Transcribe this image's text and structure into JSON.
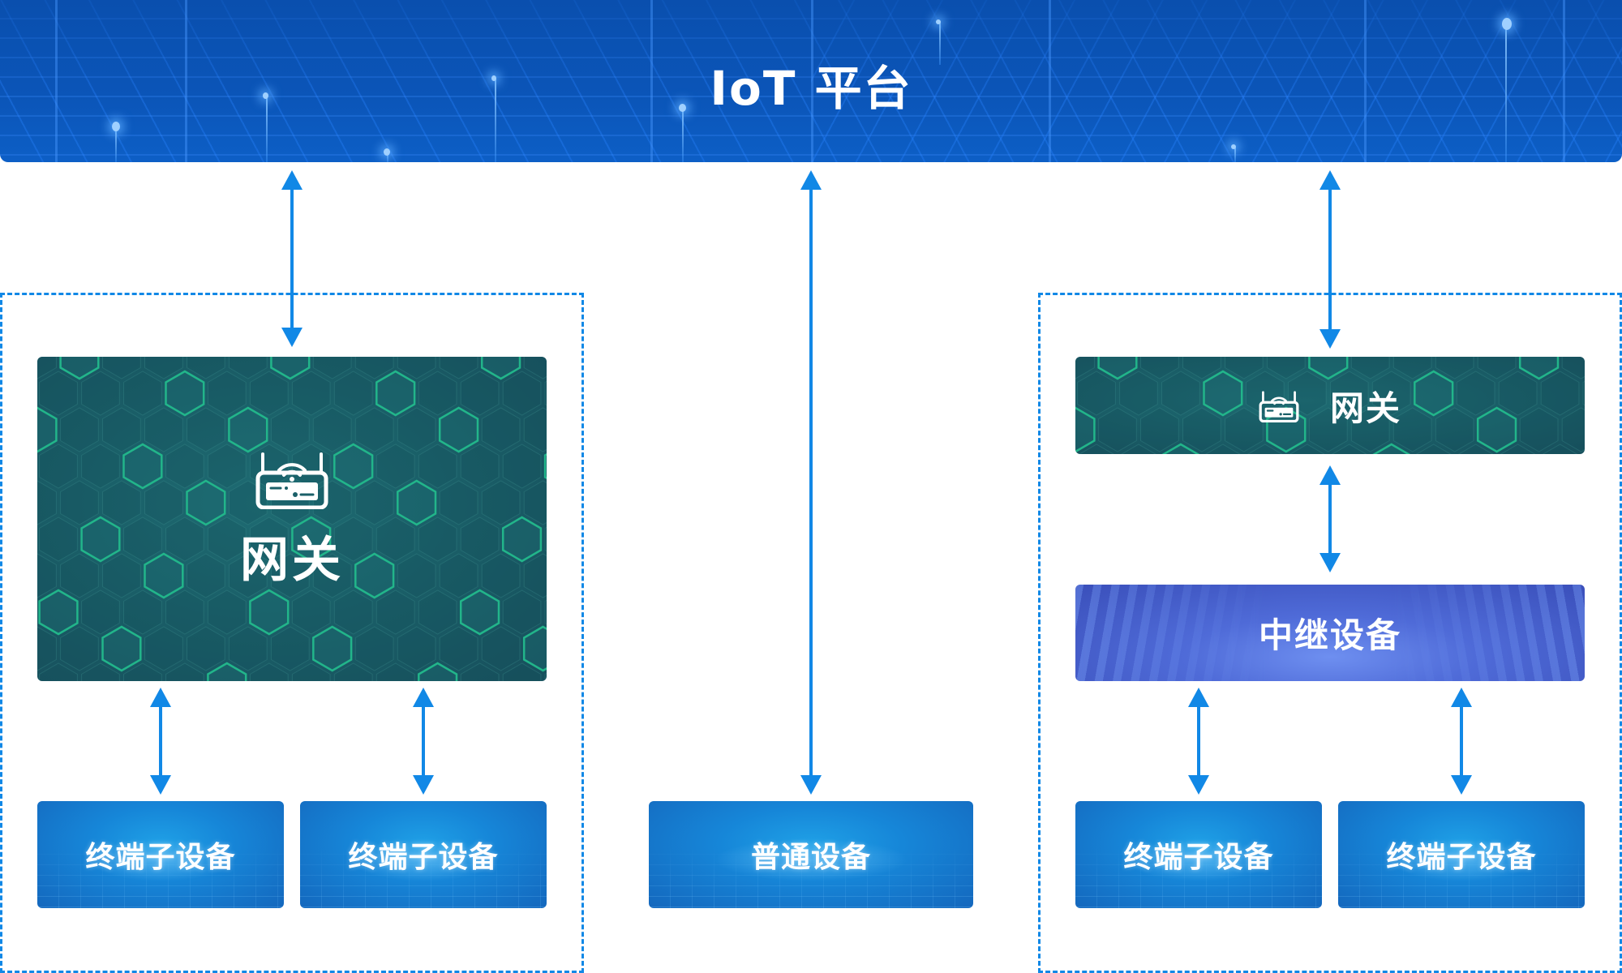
{
  "platform": {
    "title": "IoT 平台"
  },
  "colors": {
    "connector": "#1188e6",
    "banner": "#0b55b8",
    "gateway": "#1a5f68",
    "gateway_hex_edge": "#22b58a",
    "device": "#1686d8",
    "relay": "#4f6bd8"
  },
  "left_group": {
    "gateway": {
      "label": "网关",
      "icon": "router-icon"
    },
    "terminals": [
      {
        "label": "终端子设备"
      },
      {
        "label": "终端子设备"
      }
    ]
  },
  "center": {
    "device": {
      "label": "普通设备"
    }
  },
  "right_group": {
    "gateway": {
      "label": "网关",
      "icon": "router-icon"
    },
    "relay": {
      "label": "中继设备"
    },
    "terminals": [
      {
        "label": "终端子设备"
      },
      {
        "label": "终端子设备"
      }
    ]
  },
  "connections": [
    {
      "from": "IoT 平台",
      "to": "网关 (left)",
      "direction": "bidirectional"
    },
    {
      "from": "IoT 平台",
      "to": "普通设备",
      "direction": "bidirectional"
    },
    {
      "from": "IoT 平台",
      "to": "网关 (right)",
      "direction": "bidirectional"
    },
    {
      "from": "网关 (left)",
      "to": "终端子设备 1",
      "direction": "bidirectional"
    },
    {
      "from": "网关 (left)",
      "to": "终端子设备 2",
      "direction": "bidirectional"
    },
    {
      "from": "网关 (right)",
      "to": "中继设备",
      "direction": "bidirectional"
    },
    {
      "from": "中继设备",
      "to": "终端子设备 3",
      "direction": "bidirectional"
    },
    {
      "from": "中继设备",
      "to": "终端子设备 4",
      "direction": "bidirectional"
    }
  ]
}
